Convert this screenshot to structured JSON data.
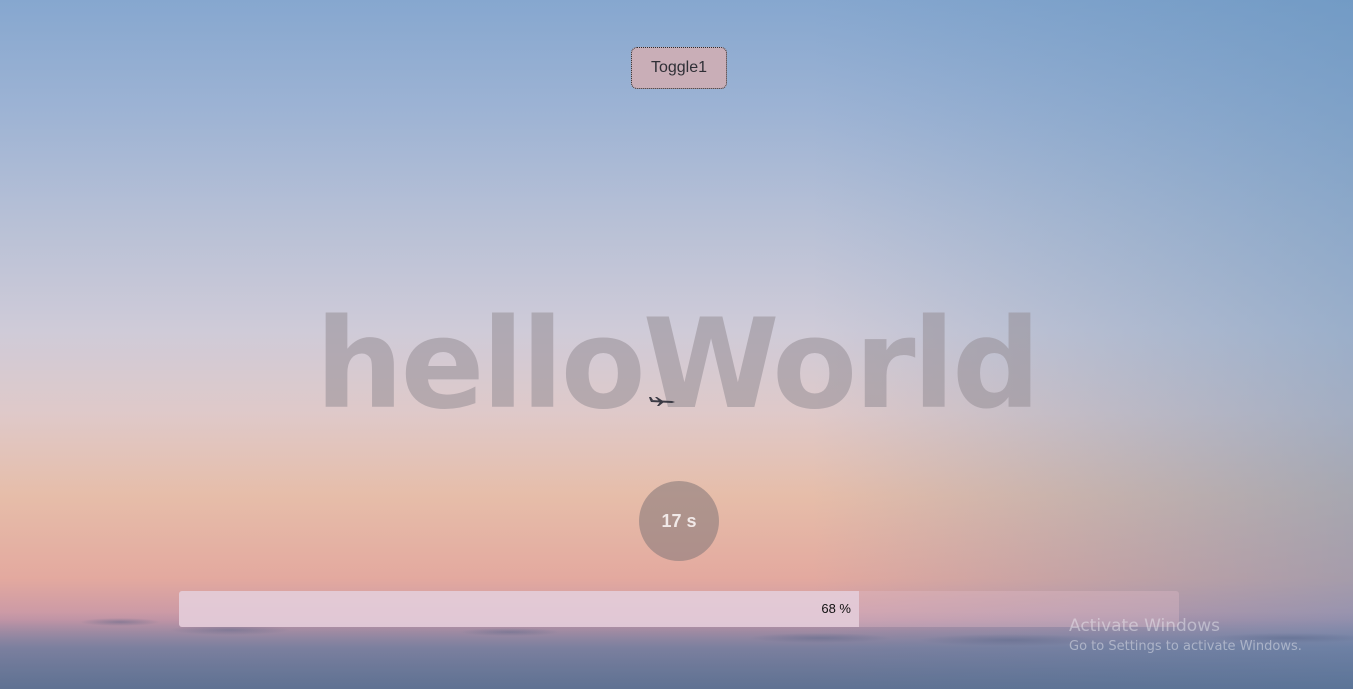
{
  "toggle_button": {
    "label": "Toggle1"
  },
  "hero": {
    "title": "helloWorld"
  },
  "timer": {
    "text": "17 s"
  },
  "progress": {
    "value": 0.68,
    "label": "68 %"
  },
  "windows_watermark": {
    "title": "Activate Windows",
    "subtitle": "Go to Settings to activate Windows."
  },
  "decorations": {
    "plane_icon": "airplane-icon"
  },
  "colors": {
    "sky_top": "#86a7cf",
    "sky_bottom": "#6f7f9c",
    "sunset": "#e6bda9",
    "toggle_background": "#c9aeb7",
    "timer_background": "#8c7d7d",
    "progress_fill": "#e4cdda"
  }
}
